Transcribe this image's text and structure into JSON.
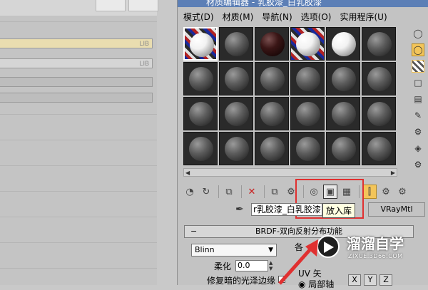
{
  "left_panel": {
    "bars": [
      {
        "lib": "LIB"
      },
      {
        "lib": "LIB"
      },
      {
        "lib": ""
      },
      {
        "lib": ""
      }
    ]
  },
  "editor": {
    "title": "材质编辑器 - 乳胶漆_白乳胶漆",
    "menu": [
      "模式(D)",
      "材质(M)",
      "导航(N)",
      "选项(O)",
      "实用程序(U)"
    ],
    "slots": [
      "checker-white",
      "grey",
      "dark",
      "checker-white",
      "white",
      "grey",
      "grey",
      "grey",
      "grey",
      "grey",
      "grey",
      "grey",
      "grey",
      "grey",
      "grey",
      "grey",
      "grey",
      "grey",
      "grey",
      "grey",
      "grey",
      "grey",
      "grey",
      "grey"
    ],
    "material_name": "r乳胶漆_白乳胶漆",
    "material_type": "VRayMtl",
    "tooltip": "放入库",
    "rollout_title": "BRDF-双向反射分布功能",
    "shader_value": "Blinn",
    "partial_label": "各",
    "soften_label": "柔化",
    "soften_value": "0.0",
    "fix_label": "修复暗的光泽边缘",
    "uv_label": "UV 矢",
    "local_axis_label": "局部轴",
    "axis_buttons": [
      "X",
      "Y",
      "Z"
    ]
  },
  "watermark": {
    "name": "溜溜自学",
    "url": "ZIXUE.3D66.COM"
  },
  "colors": {
    "accent_active": "#f3c55a",
    "highlight_box": "#e03030",
    "titlebar": "#5c7fb6"
  }
}
